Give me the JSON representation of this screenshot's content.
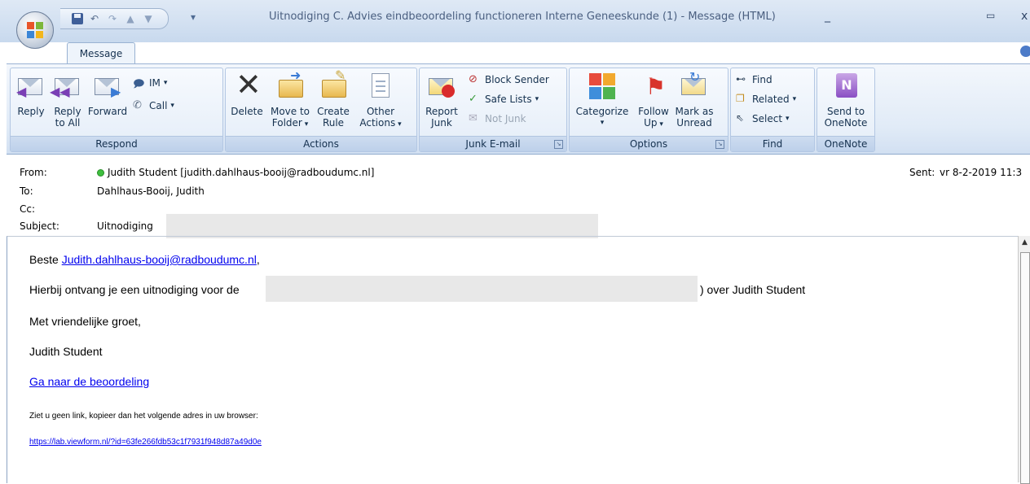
{
  "window": {
    "title": "Uitnodiging C. Advies eindbeoordeling functioneren Interne Geneeskunde (1) - Message (HTML)",
    "minimize": "_",
    "maximize": "▭",
    "close": "x"
  },
  "tabs": [
    {
      "label": "Message",
      "active": true
    }
  ],
  "ribbon": {
    "respond": {
      "label": "Respond",
      "reply": "Reply",
      "reply_all_1": "Reply",
      "reply_all_2": "to All",
      "forward": "Forward",
      "im": "IM",
      "call": "Call"
    },
    "actions": {
      "label": "Actions",
      "delete": "Delete",
      "move_1": "Move to",
      "move_2": "Folder",
      "create_1": "Create",
      "create_2": "Rule",
      "other_1": "Other",
      "other_2": "Actions"
    },
    "junk": {
      "label": "Junk E-mail",
      "report_1": "Report",
      "report_2": "Junk",
      "block": "Block Sender",
      "safe": "Safe Lists",
      "notjunk": "Not Junk"
    },
    "options": {
      "label": "Options",
      "categorize": "Categorize",
      "follow_1": "Follow",
      "follow_2": "Up",
      "mark_1": "Mark as",
      "mark_2": "Unread"
    },
    "find": {
      "label": "Find",
      "find": "Find",
      "related": "Related",
      "select": "Select"
    },
    "onenote": {
      "label": "OneNote",
      "send_1": "Send to",
      "send_2": "OneNote"
    }
  },
  "header": {
    "from_label": "From:",
    "from_value": "Judith Student [judith.dahlhaus-booij@radboudumc.nl]",
    "to_label": "To:",
    "to_value": "Dahlhaus-Booij, Judith",
    "cc_label": "Cc:",
    "subject_label": "Subject:",
    "subject_value": "Uitnodiging",
    "sent_label": "Sent:",
    "sent_value": "vr 8-2-2019 11:3"
  },
  "message": {
    "greeting": "Beste ",
    "greeting_link": "Judith.dahlhaus-booij@radboudumc.nl",
    "greeting_end": ",",
    "line1_start": "Hierbij ontvang je een uitnodiging voor de",
    "line1_end": ") over Judith Student",
    "closing": "Met vriendelijke groet,",
    "signature": "Judith Student",
    "action_link": "Ga naar de beoordeling",
    "hint": "Ziet u geen link, kopieer dan het volgende adres in uw browser:",
    "url": "https://lab.viewform.nl/?id=63fe266fdb53c1f7931f948d87a49d0e"
  }
}
